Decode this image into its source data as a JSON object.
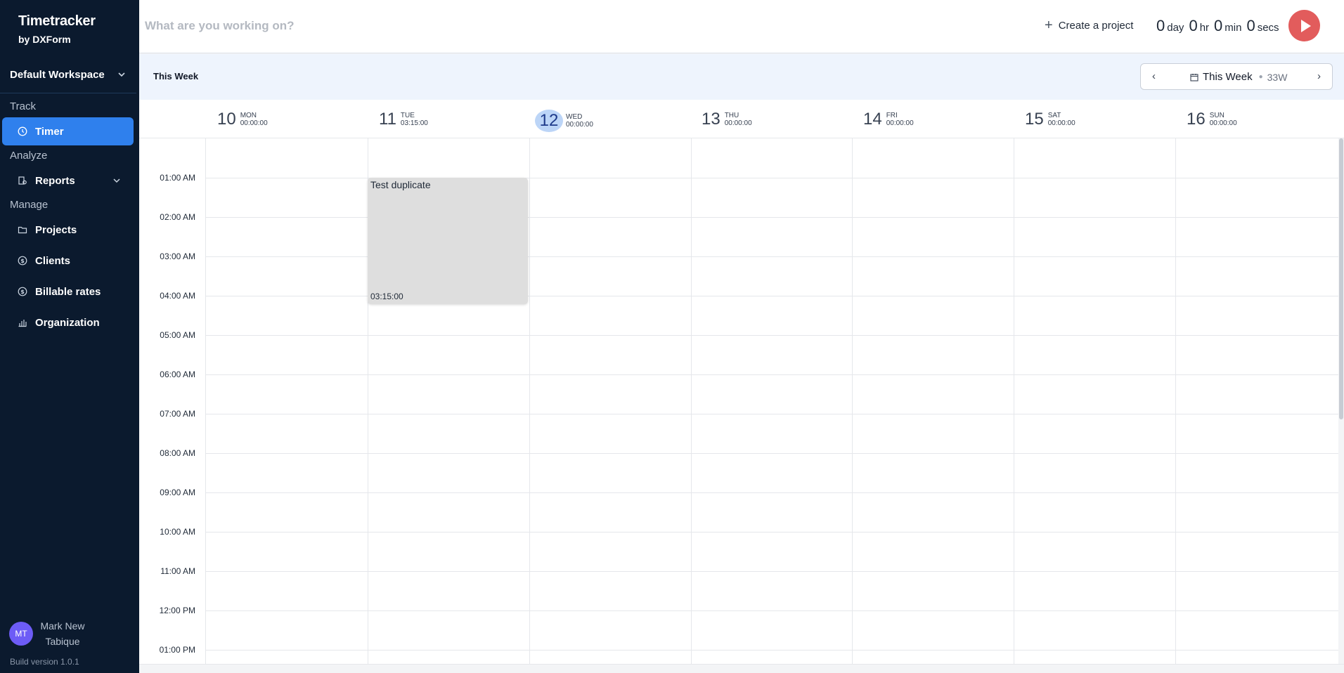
{
  "app": {
    "title": "Timetracker",
    "subtitle": "by DXForm"
  },
  "workspace": {
    "name": "Default Workspace"
  },
  "sidebar": {
    "sections": {
      "track": "Track",
      "analyze": "Analyze",
      "manage": "Manage"
    },
    "items": [
      {
        "label": "Timer",
        "icon": "clock-icon",
        "active": true
      },
      {
        "label": "Reports",
        "icon": "report-icon"
      },
      {
        "label": "Projects",
        "icon": "folder-icon"
      },
      {
        "label": "Clients",
        "icon": "dollar-circle-icon"
      },
      {
        "label": "Billable rates",
        "icon": "dollar-circle-icon"
      },
      {
        "label": "Organization",
        "icon": "bar-chart-icon"
      }
    ]
  },
  "user": {
    "initials": "MT",
    "name": "Mark New Tabique"
  },
  "build": "Build version 1.0.1",
  "topbar": {
    "placeholder": "What are you working on?",
    "create_project": "Create a project",
    "timer": {
      "day": "0",
      "day_unit": "day",
      "hr": "0",
      "hr_unit": "hr",
      "min": "0",
      "min_unit": "min",
      "sec": "0",
      "sec_unit": "secs"
    }
  },
  "weekbar": {
    "label": "This Week",
    "picker_label": "This Week",
    "week_code": "33W"
  },
  "days": [
    {
      "num": "10",
      "name": "MON",
      "total": "00:00:00"
    },
    {
      "num": "11",
      "name": "TUE",
      "total": "03:15:00"
    },
    {
      "num": "12",
      "name": "WED",
      "total": "00:00:00",
      "today": true
    },
    {
      "num": "13",
      "name": "THU",
      "total": "00:00:00"
    },
    {
      "num": "14",
      "name": "FRI",
      "total": "00:00:00"
    },
    {
      "num": "15",
      "name": "SAT",
      "total": "00:00:00"
    },
    {
      "num": "16",
      "name": "SUN",
      "total": "00:00:00"
    }
  ],
  "hours": [
    "01:00 AM",
    "02:00 AM",
    "03:00 AM",
    "04:00 AM",
    "05:00 AM",
    "06:00 AM",
    "07:00 AM",
    "08:00 AM",
    "09:00 AM",
    "10:00 AM",
    "11:00 AM",
    "12:00 PM",
    "01:00 PM"
  ],
  "event": {
    "title": "Test duplicate",
    "duration": "03:15:00"
  },
  "colors": {
    "sidebar_bg": "#0b1a2e",
    "accent": "#2f80ed",
    "play": "#e25c5c",
    "today": "#bcd5f7",
    "event_bg": "#dedede"
  }
}
